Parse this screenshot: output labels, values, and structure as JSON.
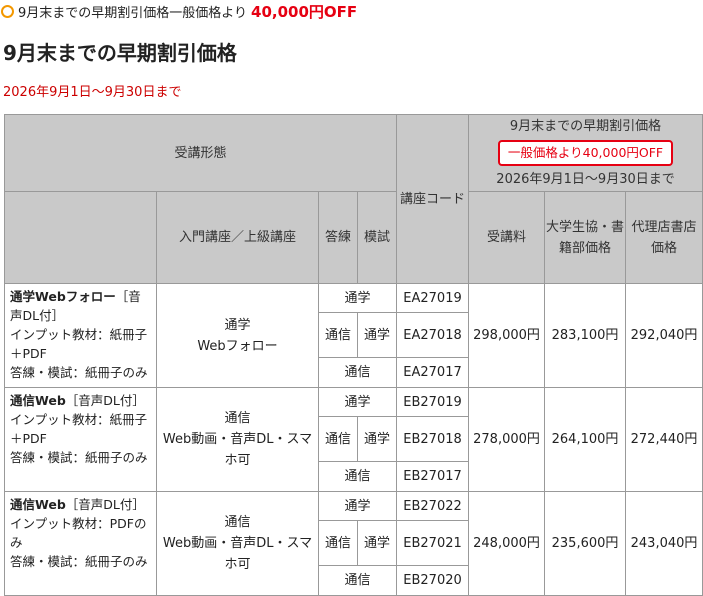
{
  "banner": {
    "text": "9月末までの早期割引価格一般価格より",
    "off": "40,000円OFF"
  },
  "heading": "9月末までの早期割引価格",
  "period": "2026年9月1日〜9月30日まで",
  "colors": {
    "accent_red": "#e60012",
    "header_gray": "#c9c9c9",
    "bullet_orange": "#f39800"
  },
  "table": {
    "headers": {
      "format": "受講形態",
      "entry_level": "入門講座／上級講座",
      "drill": "答練",
      "mock": "模試",
      "course_code": "講座コード",
      "early_title": "9月末までの早期割引価格",
      "early_badge": "一般価格より40,000円OFF",
      "early_period": "2026年9月1日〜9月30日まで",
      "fee": "受講料",
      "univ_coop": "大学生協・書籍部価格",
      "agency": "代理店書店価格"
    },
    "rows": [
      {
        "title": "通学Webフォロー",
        "audio": "［音声DL付］",
        "input_material": "インプット教材：紙冊子＋PDF",
        "drill_material": "答練・模試：紙冊子のみ",
        "entry_mode": "通学\nWebフォロー",
        "top_option": "通学",
        "mid_drill": "通信",
        "mid_mock": "通学",
        "bottom_option": "通信",
        "codes": [
          "EA27019",
          "EA27018",
          "EA27017"
        ],
        "fee": "298,000円",
        "univ": "283,100円",
        "agency": "292,040円"
      },
      {
        "title": "通信Web",
        "audio": "［音声DL付］",
        "input_material": "インプット教材：紙冊子＋PDF",
        "drill_material": "答練・模試：紙冊子のみ",
        "entry_mode": "通信\nWeb動画・音声DL・スマホ可",
        "top_option": "通学",
        "mid_drill": "通信",
        "mid_mock": "通学",
        "bottom_option": "通信",
        "codes": [
          "EB27019",
          "EB27018",
          "EB27017"
        ],
        "fee": "278,000円",
        "univ": "264,100円",
        "agency": "272,440円"
      },
      {
        "title": "通信Web",
        "audio": "［音声DL付］",
        "input_material": "インプット教材：PDFのみ",
        "drill_material": "答練・模試：紙冊子のみ",
        "entry_mode": "通信\nWeb動画・音声DL・スマホ可",
        "top_option": "通学",
        "mid_drill": "通信",
        "mid_mock": "通学",
        "bottom_option": "通信",
        "codes": [
          "EB27022",
          "EB27021",
          "EB27020"
        ],
        "fee": "248,000円",
        "univ": "235,600円",
        "agency": "243,040円"
      }
    ]
  }
}
